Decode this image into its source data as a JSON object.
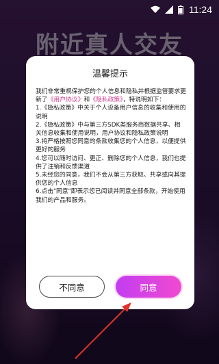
{
  "status_bar": {
    "time": "11:24"
  },
  "background": {
    "title": "附近真人交友"
  },
  "dialog": {
    "title": "温馨提示",
    "intro_1": "我们非常重视保护您的个人信息和隐私并根据监管要求更新了",
    "user_agreement_link": "《用户协议》",
    "intro_and": "和",
    "privacy_policy_link": "《隐私政策》",
    "intro_2": "，特说明如下：",
    "items": [
      "1.《隐私政策》中关于个人设备用户信息的收集和使用的说明",
      "2.《隐私政策》中与第三方SDK类服务商数据共享、相关信息收集和使用说明，用户协议和隐私政策说明",
      "3.将严格按照您同意的条款收集您的个人信息，以便提供更好的服务",
      "4.您可以随时访问、更正、删除您的个人信息，我们也提供了注销和反馈渠道",
      "5.未经您的同意，我们不会从第三方获取、共享或向其提供您的个人信息",
      "6.点击\"同意\"即表示您已阅读并同意全部条款，开始使用我们的产品和服务。"
    ],
    "decline_label": "不同意",
    "agree_label": "同意"
  },
  "colors": {
    "link": "#d23a8a",
    "agree_gradient_start": "#c23df0",
    "agree_gradient_end": "#f04ad0",
    "annotation_arrow": "#e0342a"
  },
  "icons": [
    "wifi-icon",
    "signal-icon",
    "battery-icon",
    "annotation-arrow"
  ]
}
